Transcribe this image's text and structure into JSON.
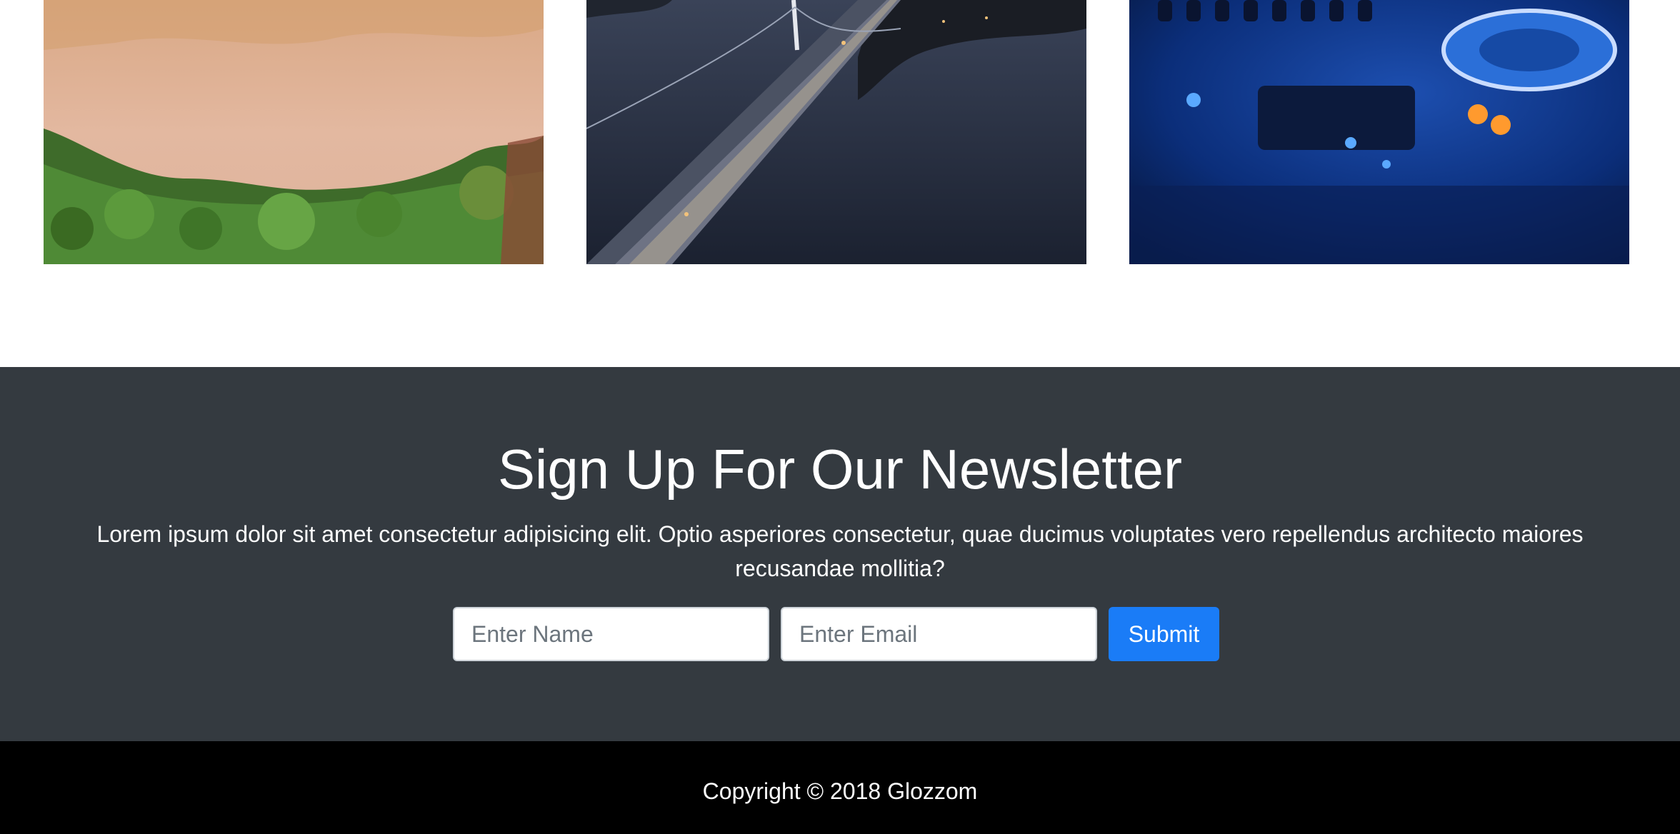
{
  "gallery": {
    "images": [
      {
        "name": "aerial-beach-forest"
      },
      {
        "name": "bridge-at-dusk"
      },
      {
        "name": "dj-controller"
      }
    ]
  },
  "newsletter": {
    "title": "Sign Up For Our Newsletter",
    "description": "Lorem ipsum dolor sit amet consectetur adipisicing elit. Optio asperiores consectetur, quae ducimus voluptates vero repellendus architecto maiores recusandae mollitia?",
    "name_placeholder": "Enter Name",
    "email_placeholder": "Enter Email",
    "submit_label": "Submit",
    "background_color": "#343a40",
    "button_color": "#1a7cf7"
  },
  "footer": {
    "copyright": "Copyright © 2018 Glozzom",
    "background_color": "#000000"
  }
}
